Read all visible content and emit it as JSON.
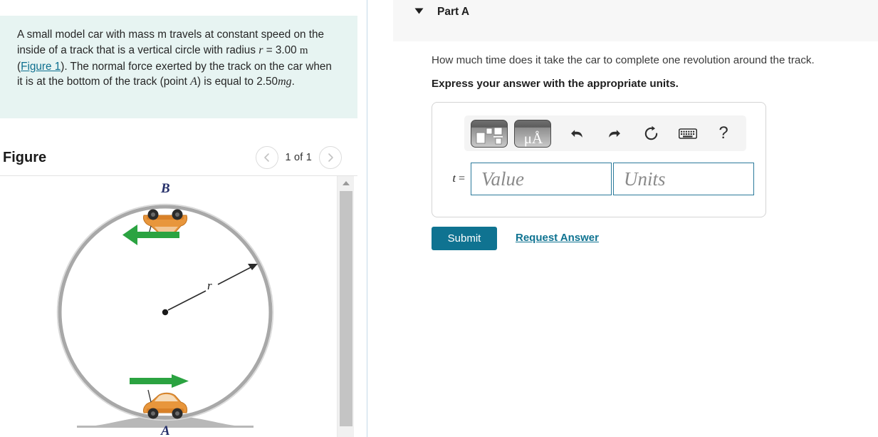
{
  "problem": {
    "text_part1": "A small model car with mass m travels at constant speed on the inside of a track that is a vertical circle with radius ",
    "radius_var": "r",
    "radius_eq": " = 3.00",
    "radius_unit": "m",
    "paren_open": " (",
    "figure_link": "Figure 1",
    "text_part2": "). The normal force exerted by the track on the car when it is at the bottom of the track (point ",
    "point_label": "A",
    "text_part3": ") is equal to 2.50",
    "mg": "mg",
    "period": "."
  },
  "figure": {
    "title": "Figure",
    "counter": "1 of 1",
    "prev_icon": "chevron-left-icon",
    "next_icon": "chevron-right-icon",
    "labels": {
      "top_point": "B",
      "bottom_point": "A",
      "radius": "r"
    },
    "colors": {
      "track": "#a8a8a8",
      "arrow_green": "#2ba341",
      "car_orange": "#e8963c",
      "ground_gray": "#b3b3b3"
    },
    "scrollbar": {
      "up_arrow_icon": "triangle-up-icon"
    }
  },
  "part": {
    "toggle_icon": "chevron-down-icon",
    "title": "Part A",
    "question": "How much time does it take the car to complete one revolution around the track.",
    "instruction": "Express your answer with the appropriate units."
  },
  "toolbar": {
    "template_button_icon": "math-template-icon",
    "units_button_label": "μÅ",
    "units_button_icon": "units-picker-icon",
    "undo_icon": "undo-icon",
    "redo_icon": "redo-icon",
    "reset_icon": "reset-icon",
    "keyboard_icon": "keyboard-icon",
    "help_icon": "help-icon",
    "help_label": "?"
  },
  "answer": {
    "variable_label": "t",
    "equals": " =",
    "value_placeholder": "Value",
    "value": "",
    "units_placeholder": "Units",
    "units": ""
  },
  "actions": {
    "submit_label": "Submit",
    "request_answer_label": "Request Answer"
  },
  "colors": {
    "accent": "#0f7391",
    "problem_bg": "#e7f4f2",
    "header_bg": "#f7f7f7",
    "field_border": "#2b7a9b",
    "divider": "#c5d9e8"
  }
}
